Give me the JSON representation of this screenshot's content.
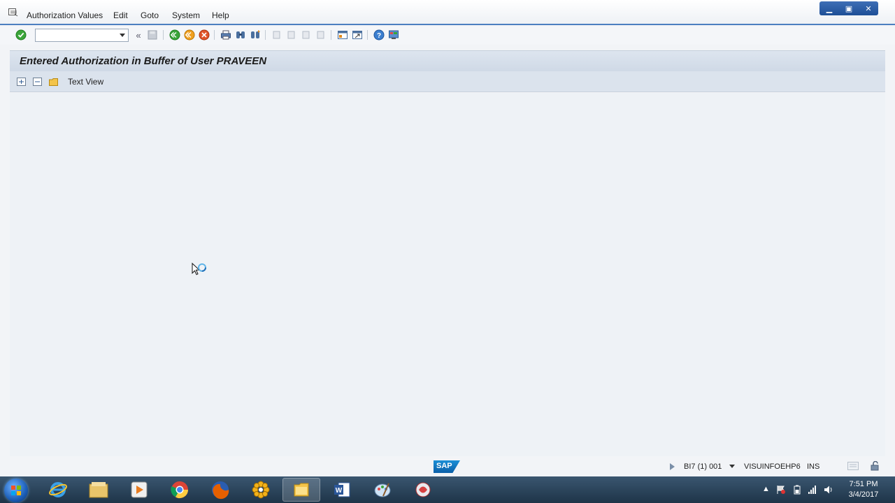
{
  "menu": {
    "items": [
      "Authorization Values",
      "Edit",
      "Goto",
      "System",
      "Help"
    ]
  },
  "window_controls": {
    "minimize": "▁",
    "restore": "▣",
    "close": "✕"
  },
  "toolbar": {
    "command_field_value": "",
    "back_label": "«",
    "icons": [
      "enter-icon",
      "save-icon",
      "back-icon",
      "exit-icon",
      "cancel-icon",
      "print-icon",
      "find-icon",
      "find-next-icon",
      "first-page-icon",
      "previous-page-icon",
      "next-page-icon",
      "last-page-icon",
      "create-session-icon",
      "shortcut-icon",
      "help-icon",
      "customize-layout-icon"
    ]
  },
  "screen": {
    "title": "Entered Authorization in Buffer of User PRAVEEN"
  },
  "app_toolbar": {
    "text_view_label": "Text View",
    "icons": [
      "expand-all-icon",
      "collapse-all-icon",
      "folder-icon"
    ]
  },
  "status_bar": {
    "sap_logo": "SAP",
    "system": "BI7 (1) 001",
    "server": "VISUINFOEHP6",
    "mode": "INS"
  },
  "taskbar": {
    "apps": [
      "internet-explorer-icon",
      "file-explorer-icon",
      "media-player-icon",
      "chrome-icon",
      "firefox-icon",
      "sap-logon-icon",
      "folder-app-icon",
      "word-icon",
      "paint-icon",
      "sap-gui-icon"
    ],
    "active_index": 6,
    "clock_time": "7:51 PM",
    "clock_date": "3/4/2017"
  },
  "colors": {
    "accent": "#4c7fc0",
    "title_strip": "#cfd9e6",
    "content_bg": "#eef2f6",
    "taskbar": "#1e3448"
  }
}
